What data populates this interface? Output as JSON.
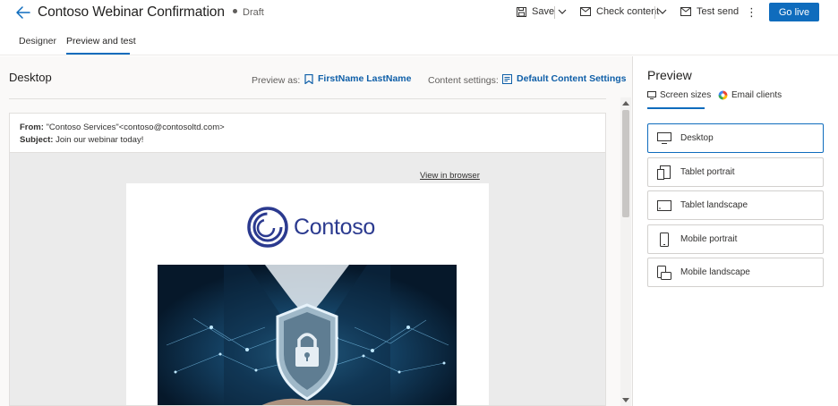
{
  "header": {
    "title": "Contoso Webinar Confirmation",
    "status": "Draft",
    "save_label": "Save",
    "check_content_label": "Check content",
    "test_send_label": "Test send",
    "more_label": "⋮",
    "go_live_label": "Go live"
  },
  "tabs": [
    {
      "label": "Designer",
      "active": false
    },
    {
      "label": "Preview and test",
      "active": true
    }
  ],
  "preview": {
    "view_title": "Desktop",
    "preview_as_label": "Preview as:",
    "preview_as_value": "FirstName LastName",
    "content_settings_label": "Content settings:",
    "content_settings_value": "Default Content Settings"
  },
  "email": {
    "from_label": "From:",
    "from_value": "\"Contoso Services\"<contoso@contosoltd.com>",
    "subject_label": "Subject:",
    "subject_value": "Join our webinar today!",
    "view_in_browser": "View in browser",
    "logo_text": "Contoso"
  },
  "side_panel": {
    "title": "Preview",
    "tabs": [
      {
        "label": "Screen sizes",
        "active": true,
        "icon": "screen-sizes-icon"
      },
      {
        "label": "Email clients",
        "active": false,
        "icon": "email-clients-icon"
      }
    ],
    "sizes": [
      {
        "label": "Desktop",
        "selected": true,
        "icon": "desktop-icon"
      },
      {
        "label": "Tablet portrait",
        "selected": false,
        "icon": "tablet-portrait-icon"
      },
      {
        "label": "Tablet landscape",
        "selected": false,
        "icon": "tablet-landscape-icon"
      },
      {
        "label": "Mobile portrait",
        "selected": false,
        "icon": "mobile-portrait-icon"
      },
      {
        "label": "Mobile landscape",
        "selected": false,
        "icon": "mobile-landscape-icon"
      }
    ]
  },
  "colors": {
    "accent": "#0f6cbd",
    "link": "#0f5fa8",
    "logo": "#2b3a8f"
  }
}
